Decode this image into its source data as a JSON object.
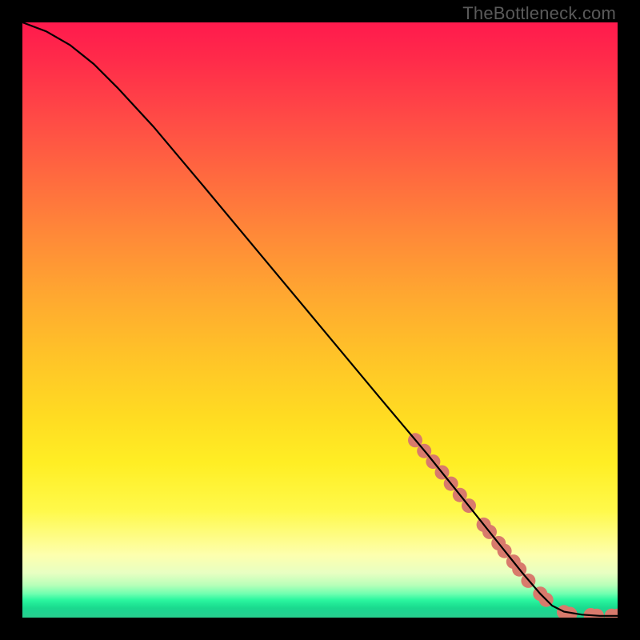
{
  "attribution": "TheBottleneck.com",
  "chart_data": {
    "type": "line",
    "title": "",
    "xlabel": "",
    "ylabel": "",
    "xlim": [
      0,
      100
    ],
    "ylim": [
      0,
      100
    ],
    "grid": false,
    "legend": false,
    "series": [
      {
        "name": "curve",
        "stroke": "#000000",
        "x": [
          0,
          4,
          8,
          12,
          16,
          22,
          30,
          40,
          50,
          60,
          68,
          74,
          80,
          84,
          87,
          89,
          91,
          94,
          97,
          100
        ],
        "y": [
          100,
          98.5,
          96.2,
          93.0,
          89.0,
          82.5,
          73.0,
          61.0,
          49.0,
          37.0,
          27.5,
          20.0,
          12.5,
          7.5,
          4.0,
          2.0,
          1.0,
          0.5,
          0.3,
          0.3
        ]
      },
      {
        "name": "dots",
        "type": "scatter",
        "marker_color": "#d87a6c",
        "x": [
          66.0,
          67.5,
          69.0,
          70.5,
          72.0,
          73.5,
          75.0,
          77.5,
          78.5,
          80.0,
          81.0,
          82.5,
          83.5,
          85.0,
          87.0,
          88.0,
          91.0,
          92.0,
          95.5,
          96.5,
          99.0,
          100.0
        ],
        "y": [
          29.8,
          28.0,
          26.2,
          24.4,
          22.5,
          20.6,
          18.8,
          15.6,
          14.4,
          12.5,
          11.2,
          9.4,
          8.1,
          6.2,
          4.0,
          3.0,
          0.9,
          0.6,
          0.4,
          0.3,
          0.3,
          0.3
        ]
      }
    ]
  }
}
